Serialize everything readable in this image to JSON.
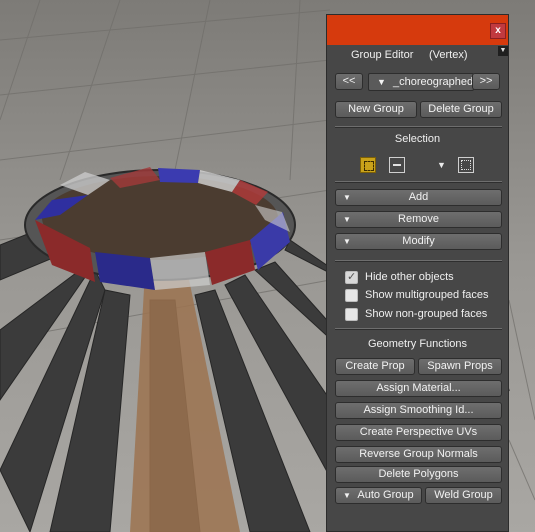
{
  "colors": {
    "title_bar": "#d63a0d",
    "close_button": "#c13a3f",
    "panel_bg": "#474747",
    "button_bg": "#606060",
    "tool_active": "#c9a21a"
  },
  "panel": {
    "title": "Group Editor",
    "mode": "(Vertex)",
    "close_glyph": "x",
    "menu_glyph": "▼",
    "nav": {
      "prev_label": "<<",
      "next_label": ">>",
      "group_name": "_choreographed_",
      "combo_caret": "▼"
    },
    "new_group_label": "New Group",
    "delete_group_label": "Delete Group",
    "selection_label": "Selection",
    "tools": {
      "add_icon": "add-selection-icon",
      "subtract_icon": "subtract-selection-icon",
      "mode_caret": "▼",
      "rect_icon": "rectangle-select-icon"
    },
    "actions": {
      "add_label": "Add",
      "remove_label": "Remove",
      "modify_label": "Modify",
      "caret": "▼"
    },
    "options": [
      {
        "label": "Hide other objects",
        "checked": true
      },
      {
        "label": "Show multigrouped faces",
        "checked": false
      },
      {
        "label": "Show non-grouped faces",
        "checked": false
      }
    ],
    "geometry_label": "Geometry Functions",
    "geometry": {
      "create_prop": "Create Prop",
      "spawn_props": "Spawn Props",
      "assign_material": "Assign Material...",
      "assign_smoothing": "Assign Smoothing Id...",
      "perspective_uvs": "Create Perspective UVs",
      "reverse_normals": "Reverse Group Normals",
      "delete_polygons": "Delete Polygons",
      "auto_group": "Auto Group",
      "weld_group": "Weld Group"
    }
  }
}
